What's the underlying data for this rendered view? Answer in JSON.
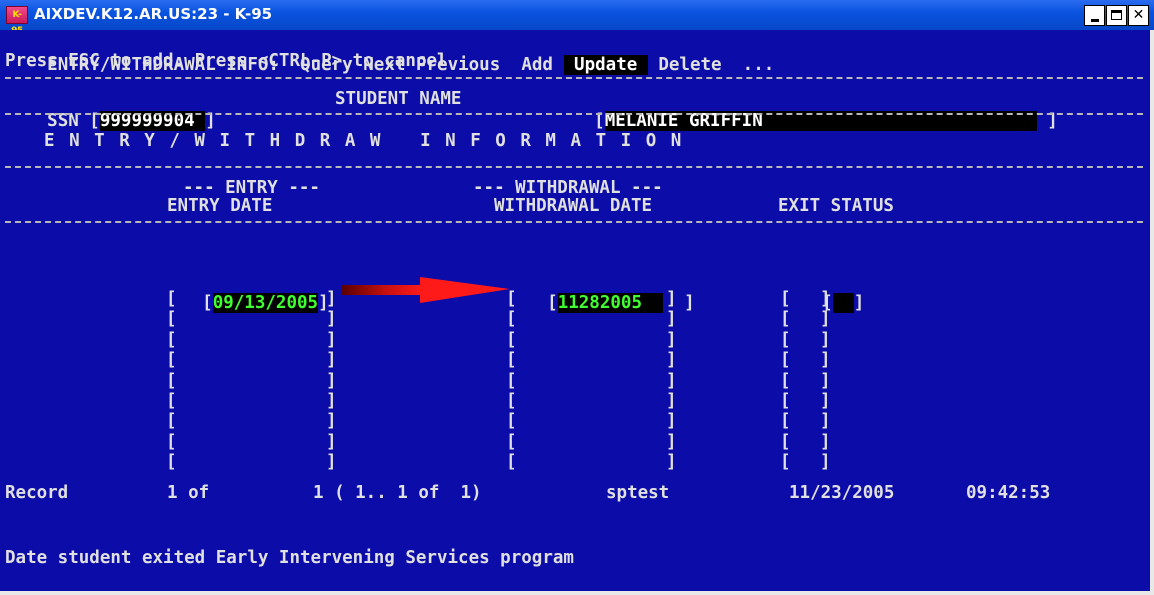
{
  "window": {
    "icon_label": "K-95",
    "title": "AIXDEV.K12.AR.US:23 - K-95"
  },
  "menu": {
    "section": "ENTRY/WITHDRAWAL INFO:",
    "items": [
      "Query",
      "Next",
      "Previous",
      "Add",
      "Update",
      "Delete",
      "..."
    ],
    "selected": "Update",
    "help": "Press ESC to add. Press <CTRL-P> to cancel"
  },
  "student": {
    "ssn_label": "SSN",
    "ssn_value": "999999904",
    "name_label": "STUDENT NAME",
    "name_value": "MELANIE GRIFFIN"
  },
  "section_title": "E N T R Y / W I T H D R A W   I N F O R M A T I O N",
  "columns": {
    "entry_group": "--- ENTRY ---",
    "entry_date": "ENTRY DATE",
    "withdrawal_group": "--- WITHDRAWAL ---",
    "withdrawal_date": "WITHDRAWAL DATE",
    "exit_status": "EXIT STATUS"
  },
  "first_row": {
    "entry_date": "09/13/2005",
    "withdrawal_date": "11282005"
  },
  "status_bar": {
    "record_label": "Record",
    "record_position": "1 of",
    "record_range": "1 ( 1.. 1 of  1)",
    "user": "sptest",
    "date": "11/23/2005",
    "time": "09:42:53"
  },
  "field_help": "Date student exited Early Intervening Services program",
  "colors": {
    "terminal_bg": "#0c0ca8",
    "field_text": "#40ff30",
    "highlight_bg": "#000000",
    "arrow": "#e01010"
  }
}
